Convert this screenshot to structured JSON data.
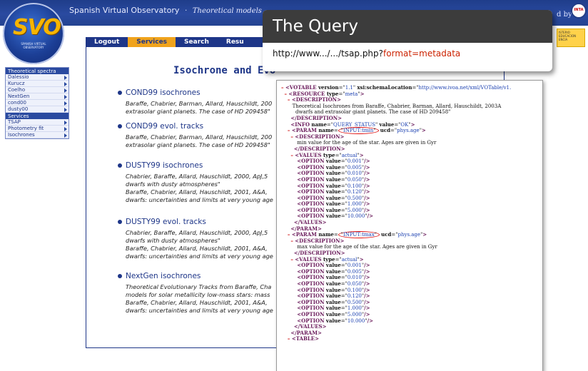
{
  "header": {
    "site_title": "Spanish Virtual Observatory",
    "site_subtitle": "Theoretical models",
    "powered_by": "d by",
    "inta_label": "INTA",
    "ministry_label": "ISTERIO EDUCACION ENCIA"
  },
  "logo": {
    "text": "SVO",
    "caption": "SPANISH VIRTUAL OBSERVATORY"
  },
  "navbar": {
    "items": [
      {
        "label": "Logout",
        "active": false
      },
      {
        "label": "Services",
        "active": true
      },
      {
        "label": "Search",
        "active": false
      },
      {
        "label": "Resu",
        "active": false
      }
    ]
  },
  "sidebar": {
    "section1_title": "Theoretical spectra",
    "section1_items": [
      "Dalessio",
      "Kurucz",
      "Coelho",
      "NextGen",
      "cond00",
      "dusty00"
    ],
    "section2_title": "Services",
    "section2_items": [
      "TSAP",
      "Photometry fit",
      "Isochrones"
    ]
  },
  "main": {
    "heading": "Isochrone and Evo",
    "entries": [
      {
        "title": "COND99 isochrones",
        "desc": [
          "Baraffe, Chabrier, Barman, Allard, Hauschildt, 200",
          "extrasolar giant planets. The case of HD 209458\""
        ]
      },
      {
        "title": "COND99 evol. tracks",
        "desc": [
          "Baraffe, Chabrier, Barman, Allard, Hauschildt, 200",
          "extrasolar giant planets. The case of HD 209458\""
        ]
      },
      {
        "title": "DUSTY99 isochrones",
        "desc": [
          "Chabrier, Baraffe, Allard, Hauschildt, 2000, ApJ,5",
          "dwarfs with dusty atmospheres\"",
          "Baraffe, Chabrier, Allard, Hauschildt, 2001, A&A,",
          "dwarfs: uncertainties and limits at very young age"
        ]
      },
      {
        "title": "DUSTY99 evol. tracks",
        "desc": [
          "Chabrier, Baraffe, Allard, Hauschildt, 2000, ApJ,5",
          "dwarfs with dusty atmospheres\"",
          "Baraffe, Chabrier, Allard, Hauschildt, 2001, A&A,",
          "dwarfs: uncertainties and limits at very young age"
        ]
      },
      {
        "title": "NextGen isochrones",
        "desc": [
          "Theoretical Evolutionary Tracks from Baraffe, Cha",
          "models for solar metallicity low-mass stars: mass",
          "Baraffe, Chabrier, Allard, Hauschildt, 2001, A&A,",
          "dwarfs: uncertainties and limits at very young age"
        ]
      }
    ]
  },
  "query": {
    "title": "The Query",
    "url_prefix": "http://www.../.../tsap.php?",
    "url_param": "format=metadata"
  },
  "xml": {
    "votable_version": "1.1",
    "schema_location": "http://www.ivoa.net/xml/VOTable/v1.",
    "resource_type": "meta",
    "description_line1": "Theoretical Isochrones from Baraffe, Chabrier, Barman, Allard, Hauschildt, 2003A",
    "description_line2": "dwarfs and extrasolar giant planets. The case of HD 209458\"",
    "info_name": "QUERY_STATUS",
    "info_value": "OK",
    "param1_name": "INPUT:tmin",
    "param1_ucd": "phys.age",
    "param1_desc": "min value for the age of the star. Ages are given in Gyr",
    "values_type": "actual",
    "param1_options": [
      "0.001",
      "0.005",
      "0.010",
      "0.050",
      "0.100",
      "0.120",
      "0.500",
      "1.000",
      "5.000",
      "10.000"
    ],
    "param2_name": "INPUT:tmax",
    "param2_ucd": "phys.age",
    "param2_desc": "max value for the age of the star. Ages are given in Gyr",
    "param2_options": [
      "0.001",
      "0.005",
      "0.010",
      "0.050",
      "0.100",
      "0.120",
      "0.500",
      "1.000",
      "5.000",
      "10.000"
    ]
  }
}
